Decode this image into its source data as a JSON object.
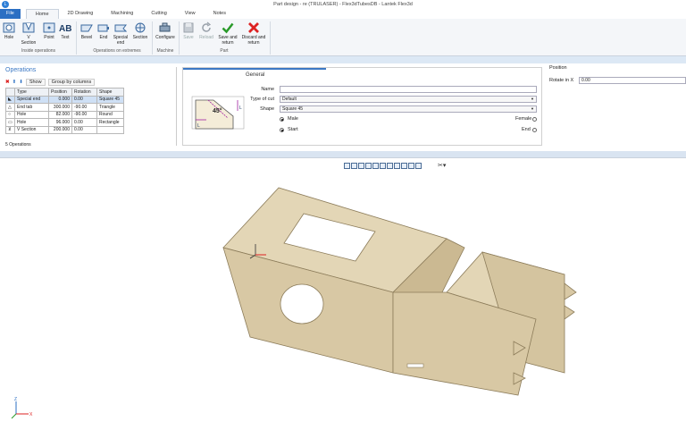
{
  "window": {
    "title": "Part design - re (TRULASER) - Flex3dTubesDB - Lantek Flex3d"
  },
  "tabs": [
    "File",
    "Home",
    "2D Drawing",
    "Machining",
    "Cutting",
    "View",
    "Notes"
  ],
  "ribbon": {
    "inside": {
      "hole": "Hole",
      "vsection": "V Section",
      "point": "Point",
      "text": "Text",
      "group": "Inside operations"
    },
    "extremes": {
      "bevel": "Bevel",
      "end": "End",
      "special_end": "Special end",
      "section": "Section",
      "group": "Operations on extremes"
    },
    "machine": {
      "configure": "Configure",
      "group": "Machine"
    },
    "part": {
      "save": "Save",
      "reload": "Reload",
      "save_return": "Save and return",
      "discard_return": "Discard and return",
      "group": "Part"
    }
  },
  "operations": {
    "title": "Operations",
    "show_label": "Show",
    "group_label": "Group by columns",
    "columns": [
      "Type",
      "Position",
      "Rotation",
      "Shape"
    ],
    "rows": [
      {
        "type": "Special end",
        "position": "0.000",
        "rotation": "0.00",
        "shape": "Square 45"
      },
      {
        "type": "End tab",
        "position": "300.000",
        "rotation": "-90.00",
        "shape": "Triangle"
      },
      {
        "type": "Hole",
        "position": "82.000",
        "rotation": "-90.00",
        "shape": "Round"
      },
      {
        "type": "Hole",
        "position": "96.000",
        "rotation": "0.00",
        "shape": "Rectangle"
      },
      {
        "type": "V Section",
        "position": "200.000",
        "rotation": "0.00",
        "shape": ""
      }
    ],
    "count": "5 Operations"
  },
  "general": {
    "title": "General",
    "name_label": "Name",
    "name_value": "",
    "typecut_label": "Type of cut",
    "typecut_value": "Default",
    "shape_label": "Shape",
    "shape_value": "Square 45",
    "male": "Male",
    "female": "Female",
    "start": "Start",
    "end": "End",
    "angle": "45°"
  },
  "position": {
    "title": "Position",
    "rotate_label": "Rotate in X",
    "rotate_value": "0.00"
  },
  "colors": {
    "accent": "#2b6fc3",
    "part": "#d8c8a4",
    "part_dark": "#b9a77f"
  }
}
